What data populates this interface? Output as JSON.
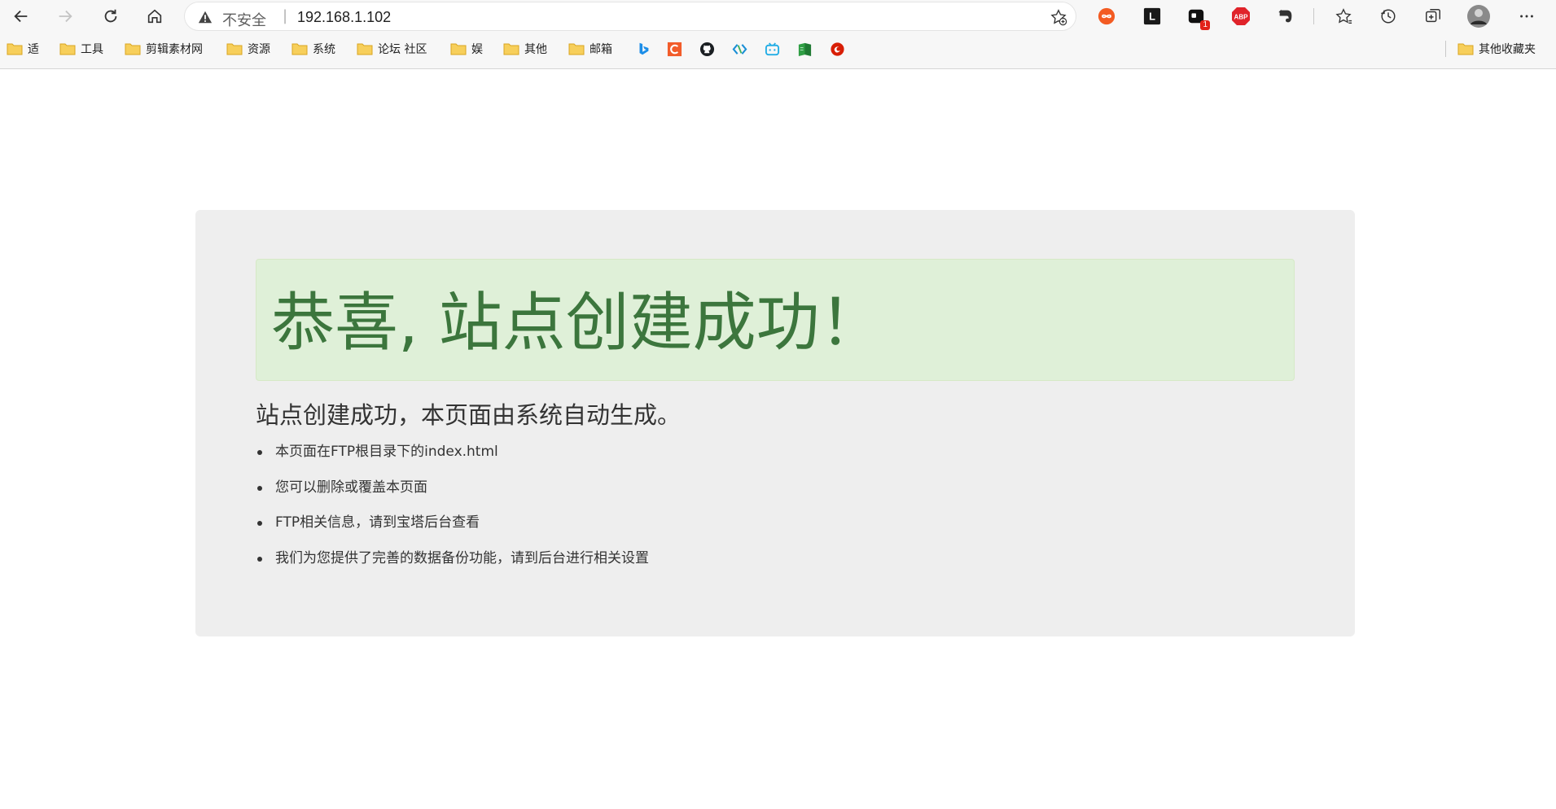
{
  "address_bar": {
    "security_label": "不安全",
    "url": "192.168.1.102"
  },
  "bookmarks": [
    {
      "label": "适"
    },
    {
      "label": "工具"
    },
    {
      "label": "剪辑素材网"
    },
    {
      "label": "资源"
    },
    {
      "label": "系统"
    },
    {
      "label": "论坛 社区"
    },
    {
      "label": "娱"
    },
    {
      "label": "其他"
    },
    {
      "label": "邮箱"
    }
  ],
  "other_bookmarks_label": "其他收藏夹",
  "extensions": {
    "badge_count": "1",
    "abp_label": "ABP",
    "lol_label": "L"
  },
  "page": {
    "alert_title": "恭喜, 站点创建成功！",
    "subtitle": "站点创建成功，本页面由系统自动生成。",
    "tips": [
      "本页面在FTP根目录下的index.html",
      "您可以删除或覆盖本页面",
      "FTP相关信息，请到宝塔后台查看",
      "我们为您提供了完善的数据备份功能，请到后台进行相关设置"
    ]
  },
  "colors": {
    "alert_bg": "#dff0d8",
    "alert_text": "#3c763d",
    "panel_bg": "#eeeeee"
  }
}
